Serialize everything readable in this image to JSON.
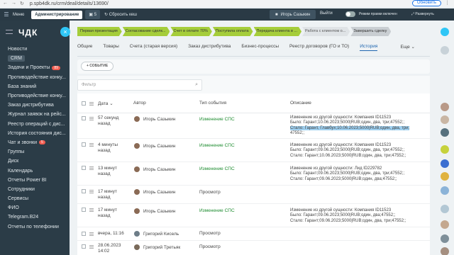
{
  "browser": {
    "url": "p.spb4dk.ru/crm/deal/details/13690/",
    "update_label": "Обновить"
  },
  "topbar": {
    "menu_label": "Меню",
    "admin_label": "Администрирование",
    "chat_count": "5",
    "cache_label": "Сбросить кеш",
    "user_name": "Игорь Сазыкин",
    "logout_label": "Выйти",
    "mode_label": "Режим правки включен",
    "unfold_label": "Развернуть"
  },
  "leftnav": {
    "logo": "ЧДК",
    "items": [
      {
        "label": "Новости"
      },
      {
        "label": "CRM"
      },
      {
        "label": "Задачи и Проекты",
        "badge": "89"
      },
      {
        "label": "Противодействие конку..."
      },
      {
        "label": "База знаний"
      },
      {
        "label": "Противодействие конку..."
      },
      {
        "label": "Заказ дистрибутива"
      },
      {
        "label": "Журнал заявок на рейс..."
      },
      {
        "label": "Реестр операций с дис..."
      },
      {
        "label": "История состояния дис..."
      },
      {
        "label": "Чат и звонки",
        "badge": "5"
      },
      {
        "label": "Группы"
      },
      {
        "label": "Диск"
      },
      {
        "label": "Календарь"
      },
      {
        "label": "Отчеты Power BI"
      },
      {
        "label": "Сотрудники"
      },
      {
        "label": "Сервисы"
      },
      {
        "label": "ФИО"
      },
      {
        "label": "Telegram.B24"
      },
      {
        "label": "Отчеты по телефонии"
      }
    ]
  },
  "stages": [
    {
      "label": "Первая презентация",
      "state": "done"
    },
    {
      "label": "Согласование сделк...",
      "state": "done"
    },
    {
      "label": "Счет в оплате 70%",
      "state": "done"
    },
    {
      "label": "Поступила оплата",
      "state": "done"
    },
    {
      "label": "Передача клиента в ...",
      "state": "done"
    },
    {
      "label": "Работа с клиентом о...",
      "state": "todo"
    },
    {
      "label": "Завершить сделку",
      "state": "final"
    }
  ],
  "tabs": [
    {
      "label": "Общие"
    },
    {
      "label": "Товары"
    },
    {
      "label": "Счета (старая версия)"
    },
    {
      "label": "Заказ дистрибутива"
    },
    {
      "label": "Бизнес-процессы"
    },
    {
      "label": "Реестр договоров (ГО и ТО)"
    },
    {
      "label": "История",
      "active": true
    }
  ],
  "tabs_more": "Еще",
  "event_button": "+ СОБЫТИЕ",
  "filter_placeholder": "Фильтр",
  "grid": {
    "columns": {
      "date": "Дата",
      "author": "Автор",
      "type": "Тип события",
      "desc": "Описание"
    },
    "rows": [
      {
        "date1": "57 секунд",
        "date2": "назад",
        "author": "Игорь Сазыкин",
        "type": "Изменение СПС",
        "type_green": true,
        "desc": [
          "Изменение из другой сущности: Компания ID11523",
          "Было: Гарант;10.06.2023;5000|RUB;один, два, три;47552;;",
          "Стало: Гарант, Главбух;10.06.2023;5000|RUB;один, два, три;",
          "47552;;"
        ]
      },
      {
        "date1": "4 минуты",
        "date2": "назад",
        "author": "Игорь Сазыкин",
        "type": "Изменение СПС",
        "type_green": true,
        "desc": [
          "Изменение из другой сущности: Компания ID11523",
          "Было: Гарант;09.06.2023;5000|RUB;один, два, три;47552;;",
          "Стало: Гарант;10.06.2023;5000|RUB;один, два, три;47552;;"
        ]
      },
      {
        "date1": "13 минут",
        "date2": "назад",
        "author": "Игорь Сазыкин",
        "type": "Изменение СПС",
        "type_green": true,
        "desc": [
          "Изменение из другой сущности: Лид ID229782",
          "Было: Гарант;09.06.2023;5000|RUB;один, два, три;47552;;",
          "Стало: Гарант;09.06.2023;5000|RUB;один, два;47552;;"
        ]
      },
      {
        "date1": "17 минут",
        "date2": "назад",
        "author": "Игорь Сазыкин",
        "type": "Просмотр",
        "type_green": false,
        "desc": []
      },
      {
        "date1": "17 минут",
        "date2": "назад",
        "author": "Игорь Сазыкин",
        "type": "Изменение СПС",
        "type_green": true,
        "desc": [
          "Изменение из другой сущности: Компания ID11523",
          "Было: Гарант;09.06.2023;5000|RUB;один, два;47552;;",
          "Стало: Гарант;09.06.2023;5000|RUB;один, два, три;47552;;"
        ]
      },
      {
        "date1": "вчера, 11:16",
        "date2": "",
        "author": "Григорий Кисель",
        "type": "Просмотр",
        "type_green": false,
        "desc": []
      },
      {
        "date1": "28.06.2023",
        "date2": "14:02",
        "author": "Григорий Третьяк",
        "type": "Просмотр",
        "type_green": false,
        "desc": []
      }
    ]
  },
  "colors": {
    "stage_done": "#a5cd3a",
    "accent": "#2fc6f6",
    "topbar": "#2a3a45",
    "green_text": "#1e8c30"
  }
}
